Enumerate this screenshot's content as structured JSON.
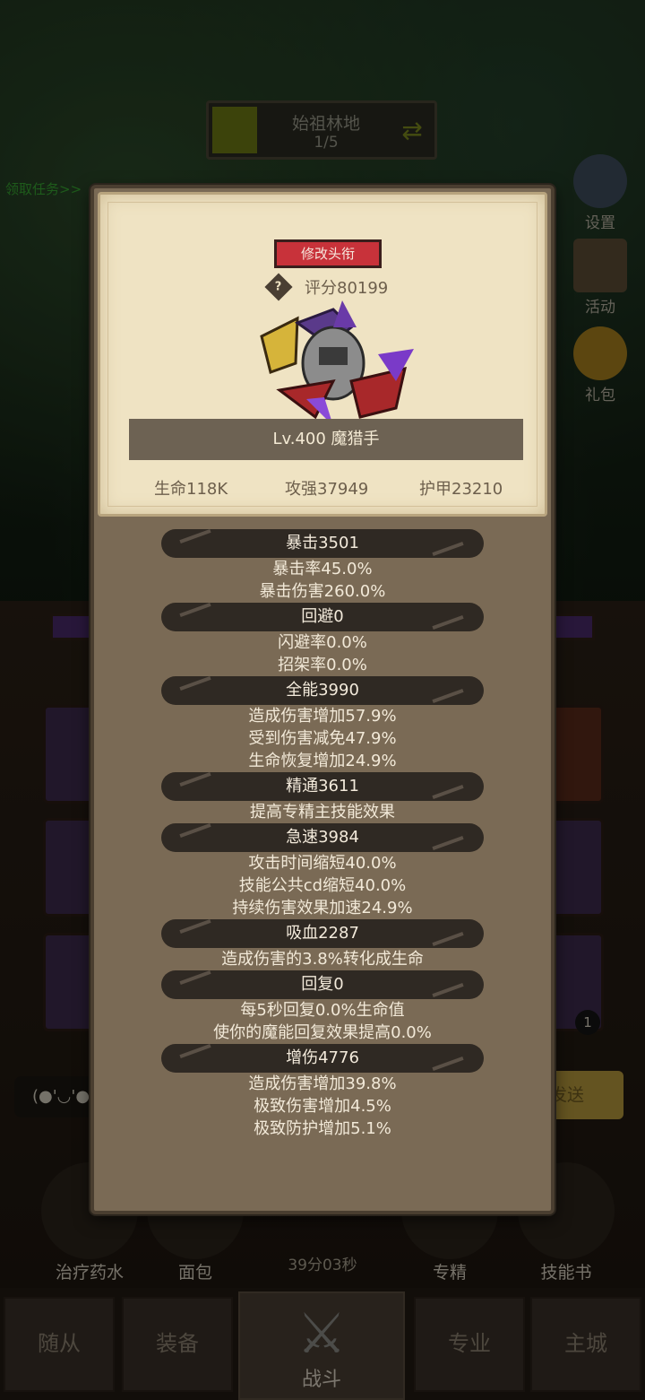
{
  "background": {
    "stage": {
      "name": "始祖林地",
      "progress": "1/5"
    },
    "quest_link": "领取任务>>",
    "side_buttons": [
      {
        "label": "设置",
        "icon": "gear-icon"
      },
      {
        "label": "活动",
        "icon": "scroll-icon"
      },
      {
        "label": "礼包",
        "icon": "gift-icon"
      }
    ],
    "slot_badge": "1",
    "emote": "(●'◡'●",
    "send_label": "发送",
    "bottom_items": [
      {
        "label": "治疗药水",
        "icon": "potion-icon"
      },
      {
        "label": "面包",
        "icon": "bread-icon"
      },
      {
        "label": "专精",
        "icon": "spec-icon"
      },
      {
        "label": "技能书",
        "icon": "book-icon"
      }
    ],
    "timer": "39分03秒",
    "nav": [
      "随从",
      "装备",
      "战斗",
      "专业",
      "主城"
    ]
  },
  "modal": {
    "title_button": "修改头衔",
    "score": "评分80199",
    "character_name": "Lv.400 魔猎手",
    "stats": {
      "hp": "生命118K",
      "attack": "攻强37949",
      "armor": "护甲23210"
    },
    "attributes": [
      {
        "head": "暴击3501",
        "lines": [
          "暴击率45.0%",
          "暴击伤害260.0%"
        ]
      },
      {
        "head": "回避0",
        "lines": [
          "闪避率0.0%",
          "招架率0.0%"
        ]
      },
      {
        "head": "全能3990",
        "lines": [
          "造成伤害增加57.9%",
          "受到伤害减免47.9%",
          "生命恢复增加24.9%"
        ]
      },
      {
        "head": "精通3611",
        "lines": [
          "提高专精主技能效果"
        ]
      },
      {
        "head": "急速3984",
        "lines": [
          "攻击时间缩短40.0%",
          "技能公共cd缩短40.0%",
          "持续伤害效果加速24.9%"
        ]
      },
      {
        "head": "吸血2287",
        "lines": [
          "造成伤害的3.8%转化成生命"
        ]
      },
      {
        "head": "回复0",
        "lines": [
          "每5秒回复0.0%生命值",
          "使你的魔能回复效果提高0.0%"
        ]
      },
      {
        "head": "增伤4776",
        "lines": [
          "造成伤害增加39.8%",
          "极致伤害增加4.5%",
          "极致防护增加5.1%"
        ]
      }
    ]
  }
}
